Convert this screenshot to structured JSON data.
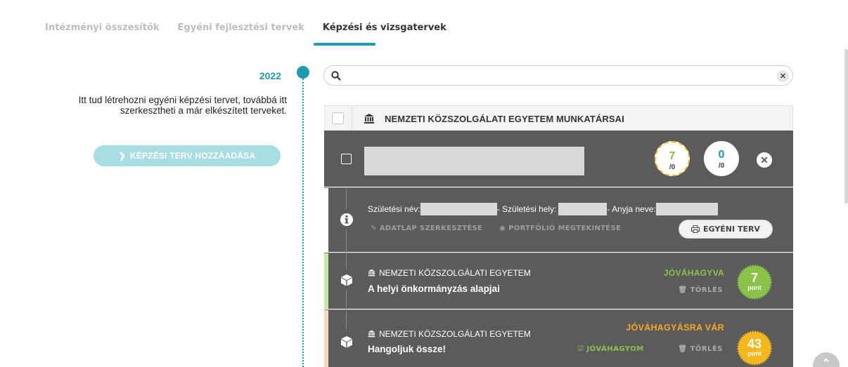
{
  "tabs": [
    {
      "label": "Intézményi összesítők",
      "active": false
    },
    {
      "label": "Egyéni fejlesztési tervek",
      "active": false
    },
    {
      "label": "Képzési és vizsgatervek",
      "active": true
    }
  ],
  "sidebar": {
    "year": "2022",
    "intro": "Itt tud létrehozni egyéni képzési tervet, továbbá itt szerkesztheti a már elkészített terveket.",
    "add_button": "KÉPZÉSI TERV HOZZÁADÁSA"
  },
  "search": {
    "value": "",
    "placeholder": ""
  },
  "org_group": {
    "name": "NEMZETI KÖZSZOLGÁLATI EGYETEM MUNKATÁRSAI"
  },
  "person": {
    "score_approved": {
      "value": "7",
      "denominator": "/0"
    },
    "score_other": {
      "value": "0",
      "denominator": "/0"
    }
  },
  "info": {
    "birth_name_label": "Születési név:",
    "birth_place_label": "- Születési hely:",
    "mother_name_label": "- Anyja neve:",
    "edit_datasheet": "ADATLAP SZERKESZTÉSE",
    "view_portfolio": "PORTFÓLIÓ MEGTEKINTÉSE",
    "individual_plan": "EGYÉNI TERV"
  },
  "courses": [
    {
      "org": "NEMZETI KÖZSZOLGÁLATI EGYETEM",
      "title": "A helyi önkormányzás alapjai",
      "status": "JÓVÁHAGYVA",
      "delete": "TÖRLÉS",
      "points": "7",
      "points_unit": "pont"
    },
    {
      "org": "NEMZETI KÖZSZOLGÁLATI EGYETEM",
      "title": "Hangoljuk össze!",
      "status": "JÓVÁHAGYÁSRA VÁR",
      "approve": "JÓVÁHAGYOM",
      "delete": "TÖRLÉS",
      "points": "43",
      "points_unit": "pont"
    }
  ],
  "colors": {
    "accent": "#1a9bb0",
    "approved": "#8bc34a",
    "pending": "#f5a623",
    "panel": "#5b5b5b"
  }
}
